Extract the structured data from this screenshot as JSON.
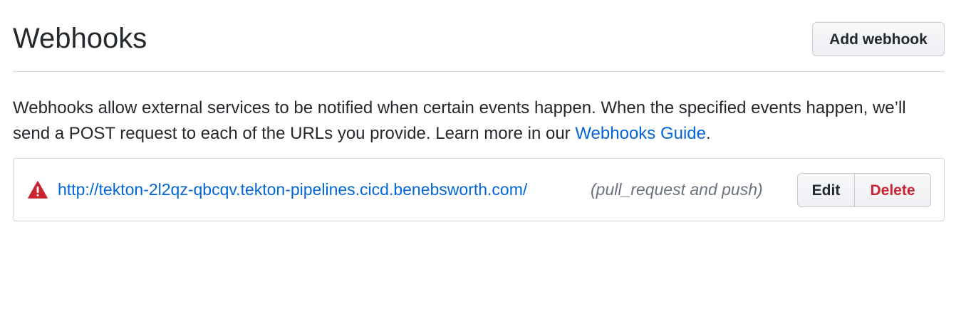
{
  "header": {
    "title": "Webhooks",
    "add_button_label": "Add webhook"
  },
  "description": {
    "text": "Webhooks allow external services to be notified when certain events happen. When the specified events happen, we’ll send a POST request to each of the URLs you provide. Learn more in our ",
    "link_label": "Webhooks Guide",
    "trailing": "."
  },
  "webhooks": [
    {
      "status_icon": "alert-icon",
      "url": "http://tekton-2l2qz-qbcqv.tekton-pipelines.cicd.benebsworth.com/",
      "events": "(pull_request and push)",
      "edit_label": "Edit",
      "delete_label": "Delete"
    }
  ],
  "colors": {
    "link": "#0366d6",
    "danger": "#cb2431",
    "text": "#24292e",
    "muted": "#6a737d",
    "border": "#d8dadd"
  }
}
